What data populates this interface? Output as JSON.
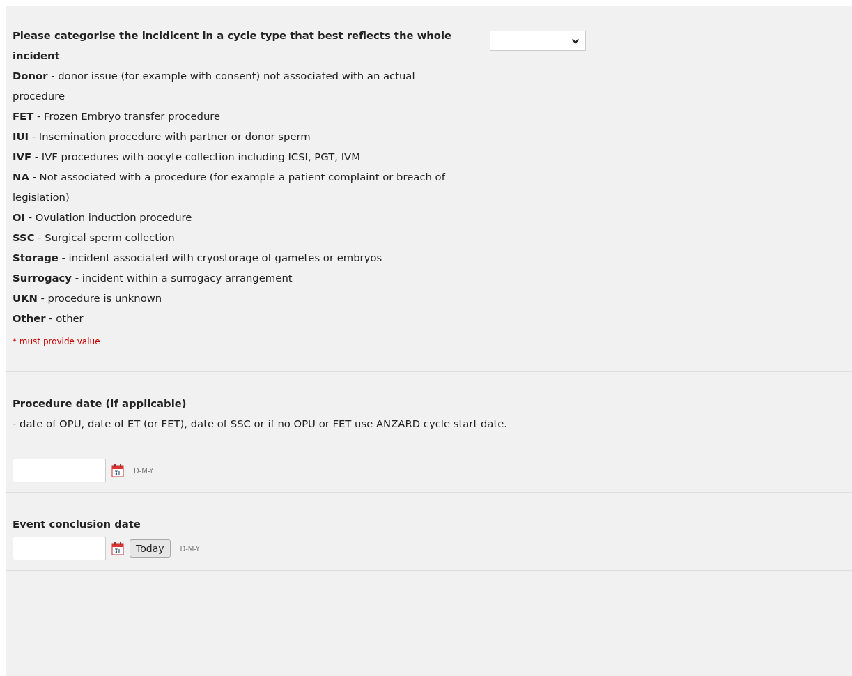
{
  "sections": [
    {
      "kind": "select",
      "label": "Please categorise the incidicent in a cycle type that best reflects the whole incident",
      "options": [
        "**Donor** - donor issue (for example with consent) not associated with an actual procedure",
        "**FET** - Frozen Embryo transfer procedure",
        "**IUI** - Insemination procedure with partner or donor sperm",
        "**IVF** - IVF procedures with oocyte collection including ICSI, PGT, IVM",
        "**NA** - Not associated with a procedure (for example a patient complaint or breach of legislation)",
        "**OI** - Ovulation induction procedure",
        "**SSC** - Surgical sperm collection",
        "**Storage** - incident associated with cryostorage of gametes or embryos",
        "**Surrogacy** - incident within a surrogacy arrangement",
        "**UKN** - procedure is unknown",
        "**Other** - other"
      ],
      "required_note": "* must provide value"
    },
    {
      "kind": "date",
      "label": "Procedure date (if applicable)",
      "description": "- date of OPU, date of ET (or FET), date of SSC or if no OPU or FET use ANZARD cycle start date.",
      "format": "D-M-Y"
    },
    {
      "kind": "date",
      "label": "Event conclusion date",
      "today_button": "Today",
      "format": "D-M-Y"
    }
  ]
}
